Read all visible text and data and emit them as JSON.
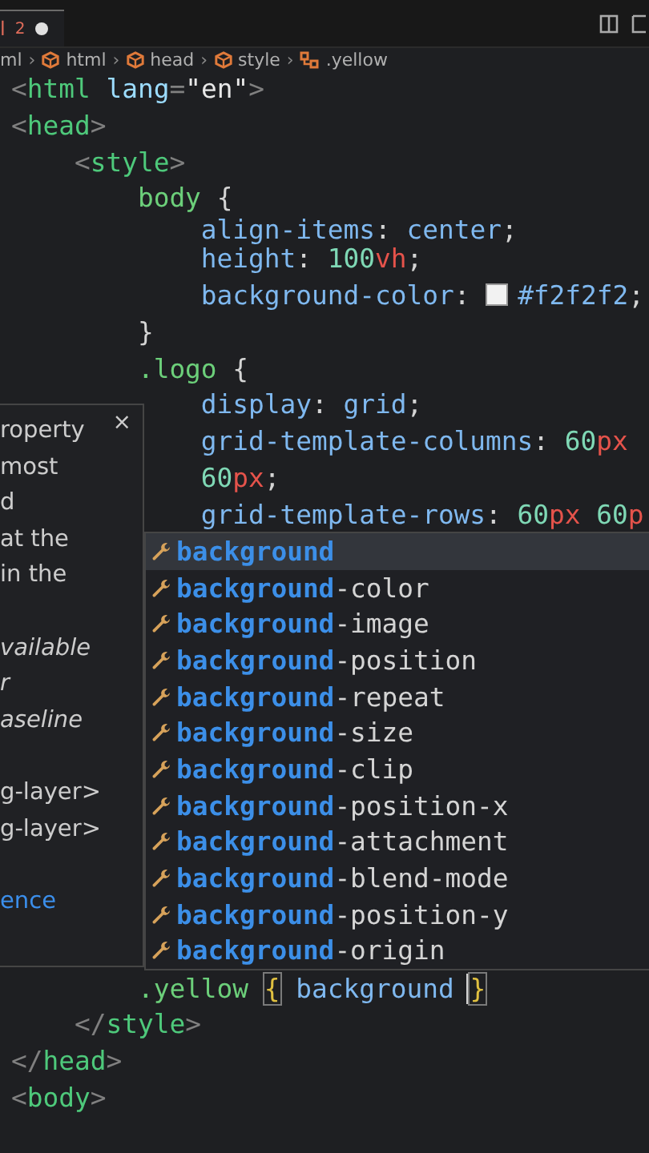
{
  "tab": {
    "label": "l",
    "problems": "2",
    "modified": true
  },
  "breadcrumb": [
    {
      "text": "ml",
      "kind": "file"
    },
    {
      "text": "›",
      "kind": "separator"
    },
    {
      "text": "html",
      "kind": "element"
    },
    {
      "text": "›",
      "kind": "separator"
    },
    {
      "text": "head",
      "kind": "element"
    },
    {
      "text": "›",
      "kind": "separator"
    },
    {
      "text": "style",
      "kind": "element"
    },
    {
      "text": "›",
      "kind": "separator"
    },
    {
      "text": ".yellow",
      "kind": "rule"
    }
  ],
  "code_before": [
    {
      "text": "<html lang=\"en\">"
    },
    {
      "text": "<head>"
    },
    {
      "text": "    <style>"
    },
    {
      "text": "        body {"
    },
    {
      "text": "            align-items: center;",
      "partial": true
    },
    {
      "text": "            height: 100vh;"
    },
    {
      "text": "            background-color: #f2f2f2;"
    },
    {
      "text": "        }"
    },
    {
      "text": "        .logo {"
    },
    {
      "text": "            display: grid;"
    },
    {
      "text": "            grid-template-columns: 60px"
    },
    {
      "text": "            60px;"
    },
    {
      "text": "            grid-template-rows: 60px 60p"
    }
  ],
  "code_after": [
    {
      "text": "        .yellow { background }",
      "cursor": true
    },
    {
      "text": "    </style>"
    },
    {
      "text": "</head>"
    },
    {
      "text": "<body>"
    }
  ],
  "hover": {
    "close": "×",
    "lines": [
      {
        "text": "roperty",
        "kind": "normal"
      },
      {
        "text": "most",
        "kind": "normal"
      },
      {
        "text": "d",
        "kind": "normal"
      },
      {
        "text": "at the",
        "kind": "normal"
      },
      {
        "text": "in the",
        "kind": "normal"
      },
      {
        "kind": "blank"
      },
      {
        "text": "vailable",
        "kind": "italic"
      },
      {
        "text": "r",
        "kind": "italic"
      },
      {
        "text": "aseline",
        "kind": "italic"
      },
      {
        "kind": "blank"
      },
      {
        "text": "g-layer>",
        "kind": "normal"
      },
      {
        "text": "g-layer>",
        "kind": "normal"
      },
      {
        "kind": "blank"
      },
      {
        "text": "ence",
        "kind": "link"
      }
    ]
  },
  "suggestions": [
    {
      "match": "background",
      "selected": true
    },
    {
      "match": "background",
      "rest": "-color",
      "selected": false
    },
    {
      "match": "background",
      "rest": "-image",
      "selected": false
    },
    {
      "match": "background",
      "rest": "-position",
      "selected": false
    },
    {
      "match": "background",
      "rest": "-repeat",
      "selected": false
    },
    {
      "match": "background",
      "rest": "-size",
      "selected": false
    },
    {
      "match": "background",
      "rest": "-clip",
      "selected": false
    },
    {
      "match": "background",
      "rest": "-position-x",
      "selected": false
    },
    {
      "match": "background",
      "rest": "-attachment",
      "selected": false
    },
    {
      "match": "background",
      "rest": "-blend-mode",
      "selected": false
    },
    {
      "match": "background",
      "rest": "-position-y",
      "selected": false
    },
    {
      "match": "background",
      "rest": "-origin",
      "selected": false
    }
  ]
}
